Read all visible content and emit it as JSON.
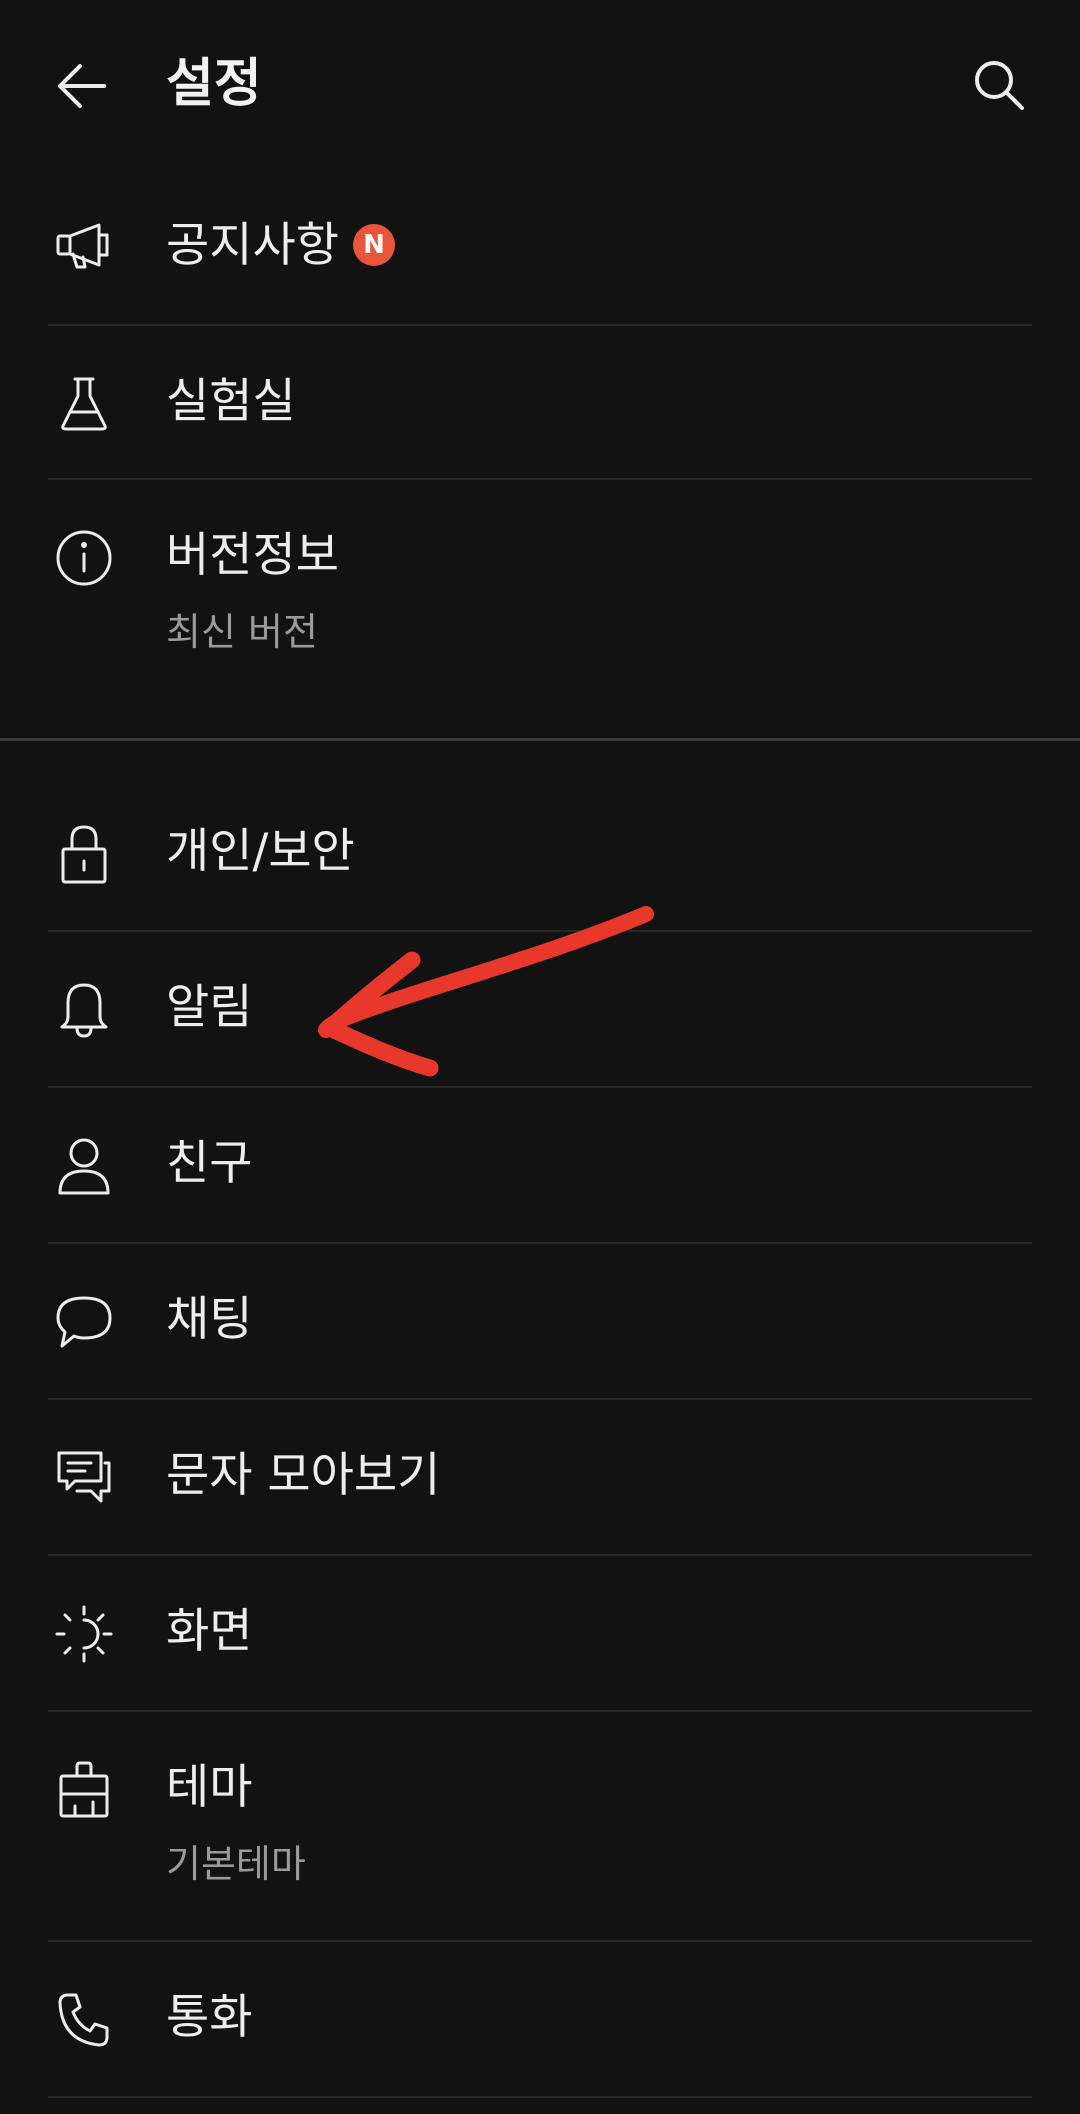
{
  "header": {
    "title": "설정",
    "back_icon": "arrow-left-icon",
    "search_icon": "search-icon"
  },
  "colors": {
    "background": "#121212",
    "text": "#ededed",
    "subtext": "#9a9a9a",
    "badge": "#e8553a",
    "annotation_arrow": "#e8382c"
  },
  "items": [
    {
      "label": "공지사항",
      "icon": "megaphone-icon",
      "badge": "N"
    },
    {
      "label": "실험실",
      "icon": "flask-icon"
    },
    {
      "label": "버전정보",
      "icon": "info-icon",
      "sub": "최신 버전"
    },
    {
      "label": "개인/보안",
      "icon": "lock-icon"
    },
    {
      "label": "알림",
      "icon": "bell-icon"
    },
    {
      "label": "친구",
      "icon": "person-icon"
    },
    {
      "label": "채팅",
      "icon": "chat-bubble-icon"
    },
    {
      "label": "문자 모아보기",
      "icon": "message-collect-icon"
    },
    {
      "label": "화면",
      "icon": "brightness-icon"
    },
    {
      "label": "테마",
      "icon": "theme-brush-icon",
      "sub": "기본테마"
    },
    {
      "label": "통화",
      "icon": "phone-icon"
    }
  ]
}
